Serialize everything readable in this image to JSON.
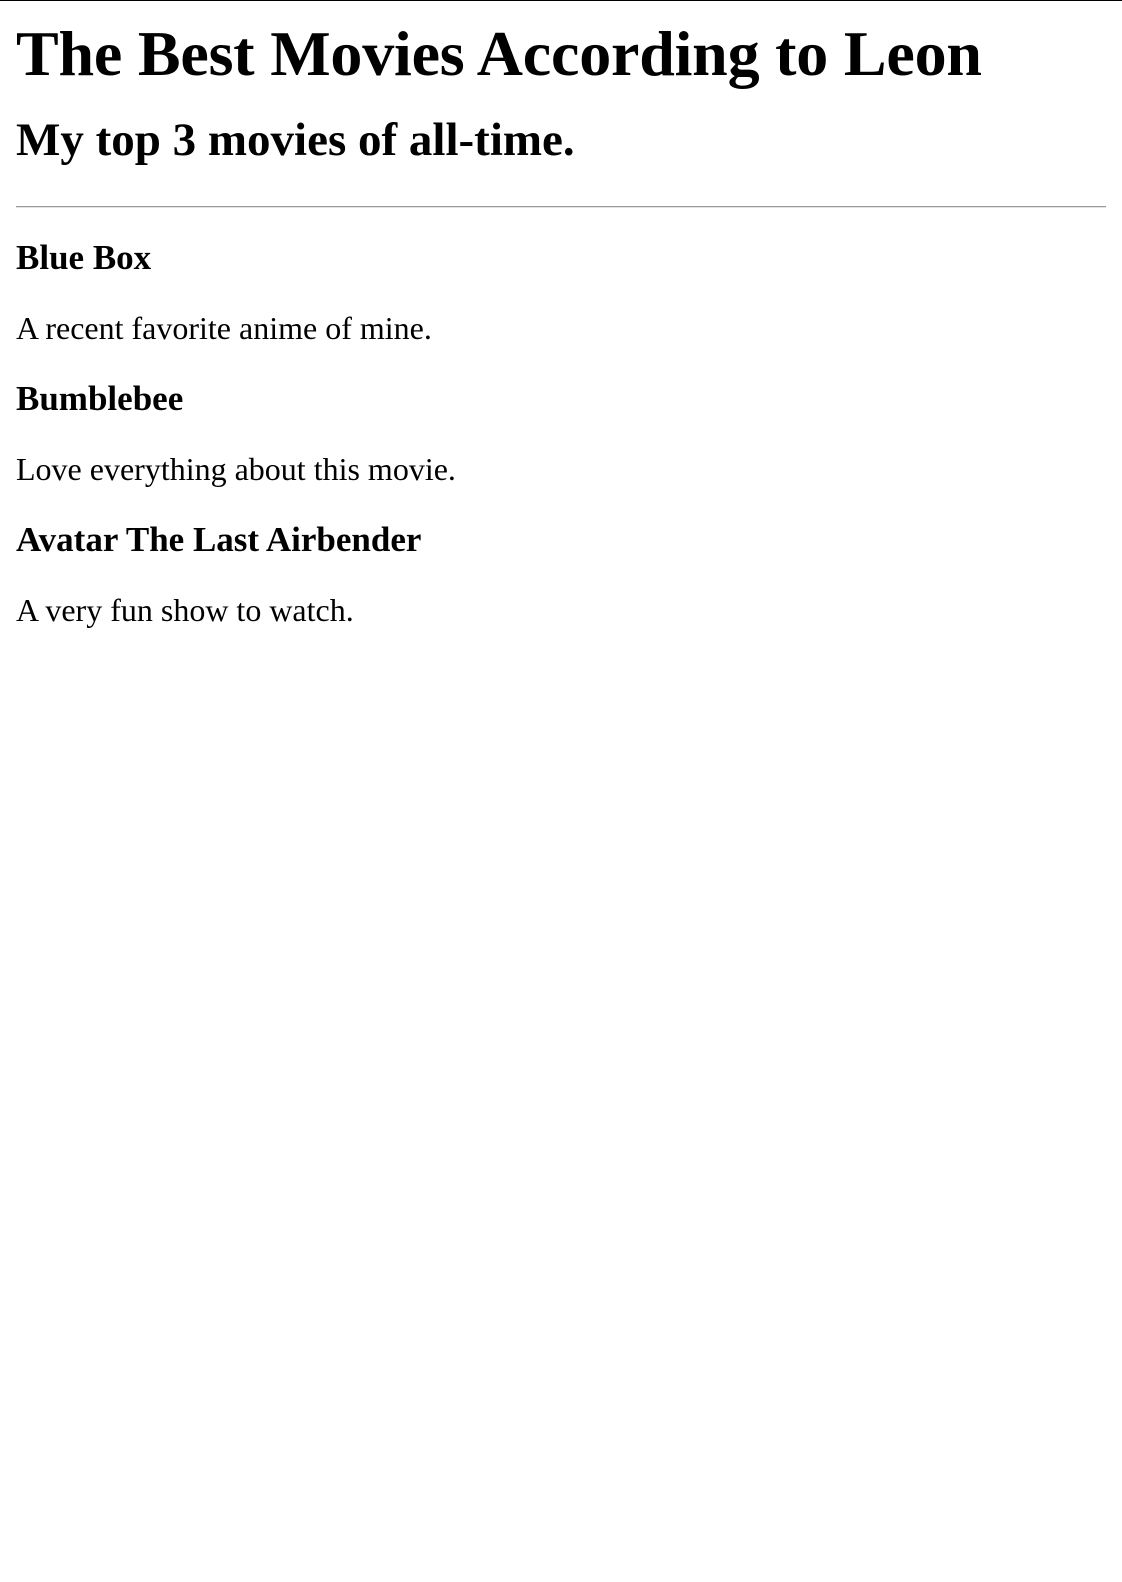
{
  "page": {
    "title": "The Best Movies According to Leon",
    "subtitle": "My top 3 movies of all-time."
  },
  "movies": [
    {
      "title": "Blue Box",
      "description": "A recent favorite anime of mine."
    },
    {
      "title": "Bumblebee",
      "description": "Love everything about this movie."
    },
    {
      "title": "Avatar The Last Airbender",
      "description": "A very fun show to watch."
    }
  ]
}
